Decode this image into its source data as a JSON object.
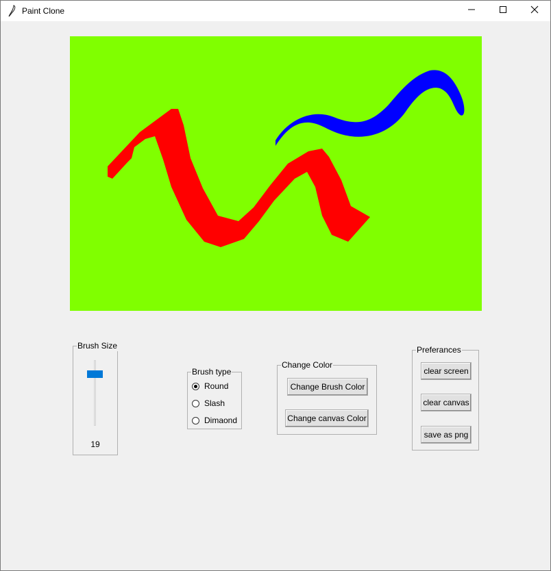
{
  "window": {
    "title": "Paint Clone",
    "icon": "feather-icon",
    "controls": [
      "minimize-icon",
      "maximize-icon",
      "close-icon"
    ]
  },
  "canvas": {
    "background_color": "#80ff00",
    "strokes": [
      {
        "color": "#ff0000",
        "shape": "red-stroke"
      },
      {
        "color": "#0000ff",
        "shape": "blue-stroke"
      }
    ]
  },
  "brush_size": {
    "label": "Brush Size",
    "value": "19"
  },
  "brush_type": {
    "label": "Brush type",
    "options": [
      "Round",
      "Slash",
      "Dimaond"
    ],
    "selected": "Round"
  },
  "change_color": {
    "label": "Change Color",
    "brush_button": "Change Brush Color",
    "canvas_button": "Change canvas Color"
  },
  "preferences": {
    "label": "Preferances",
    "clear_screen": "clear screen",
    "clear_canvas": "clear canvas",
    "save_png": "save as png"
  },
  "colors": {
    "accent": "#0078d7",
    "window_bg": "#f0f0f0"
  }
}
